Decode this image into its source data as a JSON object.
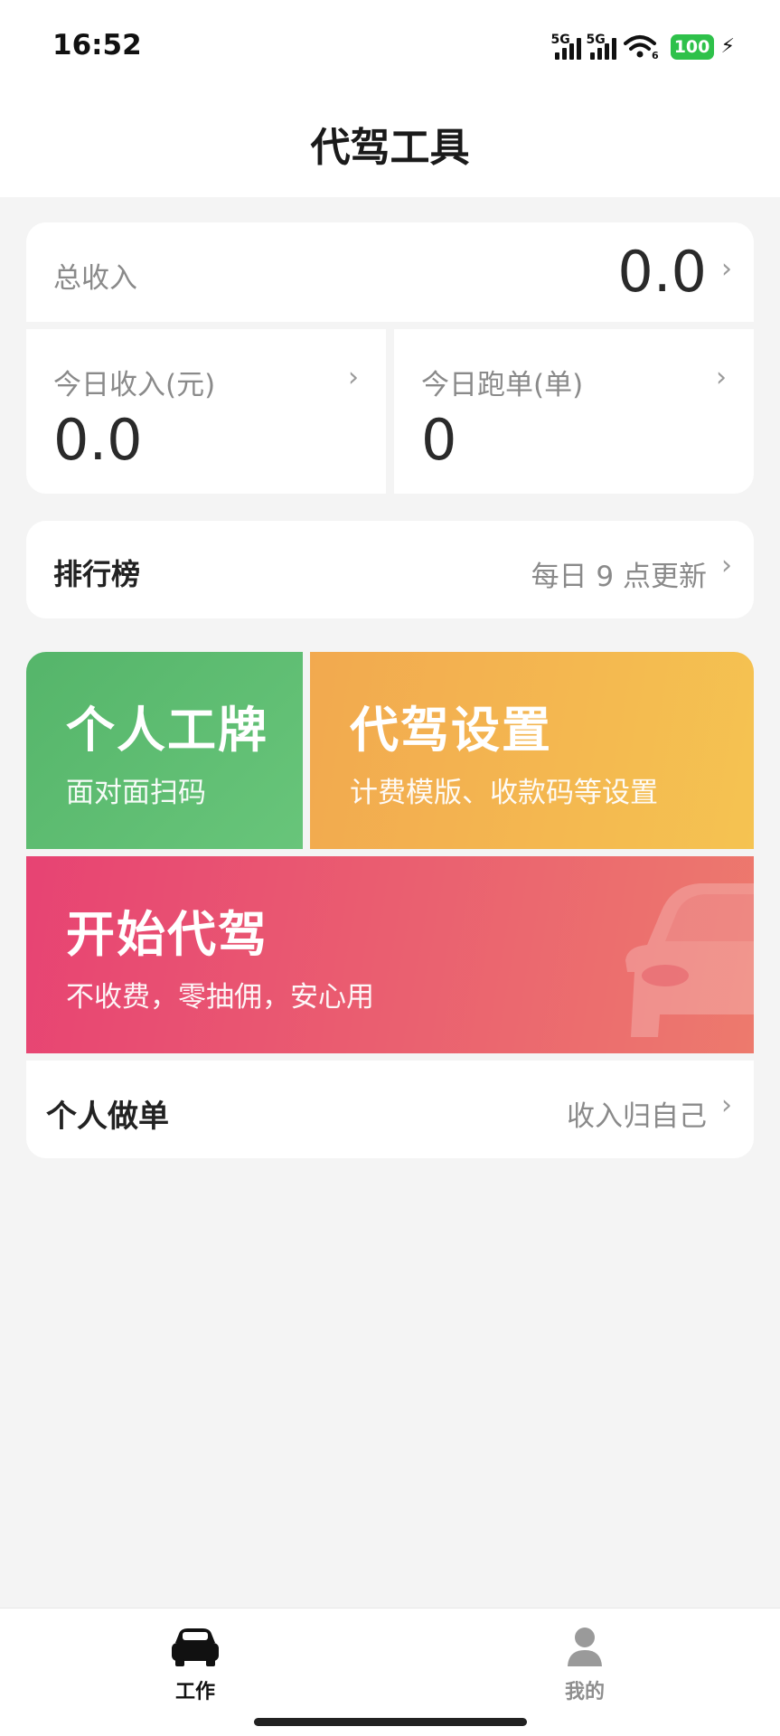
{
  "status_bar": {
    "time": "16:52",
    "signal1_label": "5G",
    "signal2_label": "5G",
    "wifi_badge": "6",
    "battery": "100",
    "battery_color": "#2ec14a"
  },
  "header": {
    "title": "代驾工具"
  },
  "stats": {
    "total_label": "总收入",
    "total_value": "0.0",
    "today_income_label": "今日收入(元)",
    "today_income_value": "0.0",
    "today_orders_label": "今日跑单(单)",
    "today_orders_value": "0",
    "chevron": "›"
  },
  "ranking": {
    "title": "排行榜",
    "note": "每日 9 点更新"
  },
  "tiles": {
    "badge": {
      "title": "个人工牌",
      "subtitle": "面对面扫码",
      "color": "#5cba70"
    },
    "settings": {
      "title": "代驾设置",
      "subtitle": "计费模版、收款码等设置",
      "color": "#f3b650"
    },
    "start": {
      "title": "开始代驾",
      "subtitle": "不收费，零抽佣，安心用",
      "color": "#e95b70",
      "icon": "car-icon"
    }
  },
  "solo": {
    "title": "个人做单",
    "note": "收入归自己"
  },
  "bottom_nav": {
    "items": [
      {
        "label": "工作",
        "icon": "car-icon",
        "active": true
      },
      {
        "label": "我的",
        "icon": "person-icon",
        "active": false
      }
    ]
  }
}
